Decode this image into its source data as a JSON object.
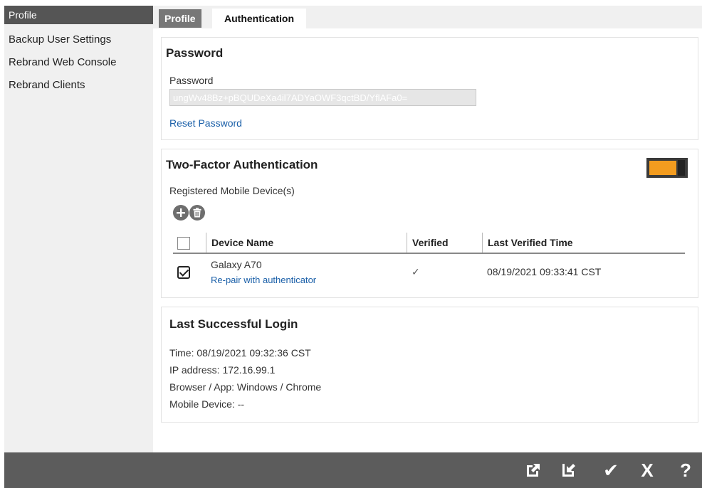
{
  "sidebar": {
    "items": [
      {
        "label": "Profile"
      },
      {
        "label": "Backup User Settings"
      },
      {
        "label": "Rebrand Web Console"
      },
      {
        "label": "Rebrand Clients"
      }
    ]
  },
  "tabs": [
    {
      "label": "Profile"
    },
    {
      "label": "Authentication"
    }
  ],
  "password": {
    "heading": "Password",
    "label": "Password",
    "value": "ungWv48Bz+pBQUDeXa4il7ADYaOWF3qctBD/YflAFa0=",
    "reset_link": "Reset Password"
  },
  "two_factor": {
    "heading": "Two-Factor Authentication",
    "enabled": true,
    "toggle_color": "#f39c1f",
    "registered_label": "Registered Mobile Device(s)",
    "add_icon": "plus-icon",
    "delete_icon": "trash-icon",
    "columns": [
      "Device Name",
      "Verified",
      "Last Verified Time"
    ],
    "devices": [
      {
        "name": "Galaxy A70",
        "action": "Re-pair with authenticator",
        "verified": "✓",
        "last_verified": "08/19/2021 09:33:41 CST",
        "checked": true
      }
    ]
  },
  "last_login": {
    "heading": "Last Successful Login",
    "time": "Time: 08/19/2021 09:32:36 CST",
    "ip": "IP address: 172.16.99.1",
    "browser": "Browser / App: Windows / Chrome",
    "mobile": "Mobile Device: --"
  },
  "bottom_bar": {
    "icons": [
      "export-icon",
      "import-icon",
      "save-check-icon",
      "close-icon",
      "help-icon"
    ],
    "glyphs": {
      "check": "✔",
      "close": "X",
      "help": "?"
    }
  }
}
